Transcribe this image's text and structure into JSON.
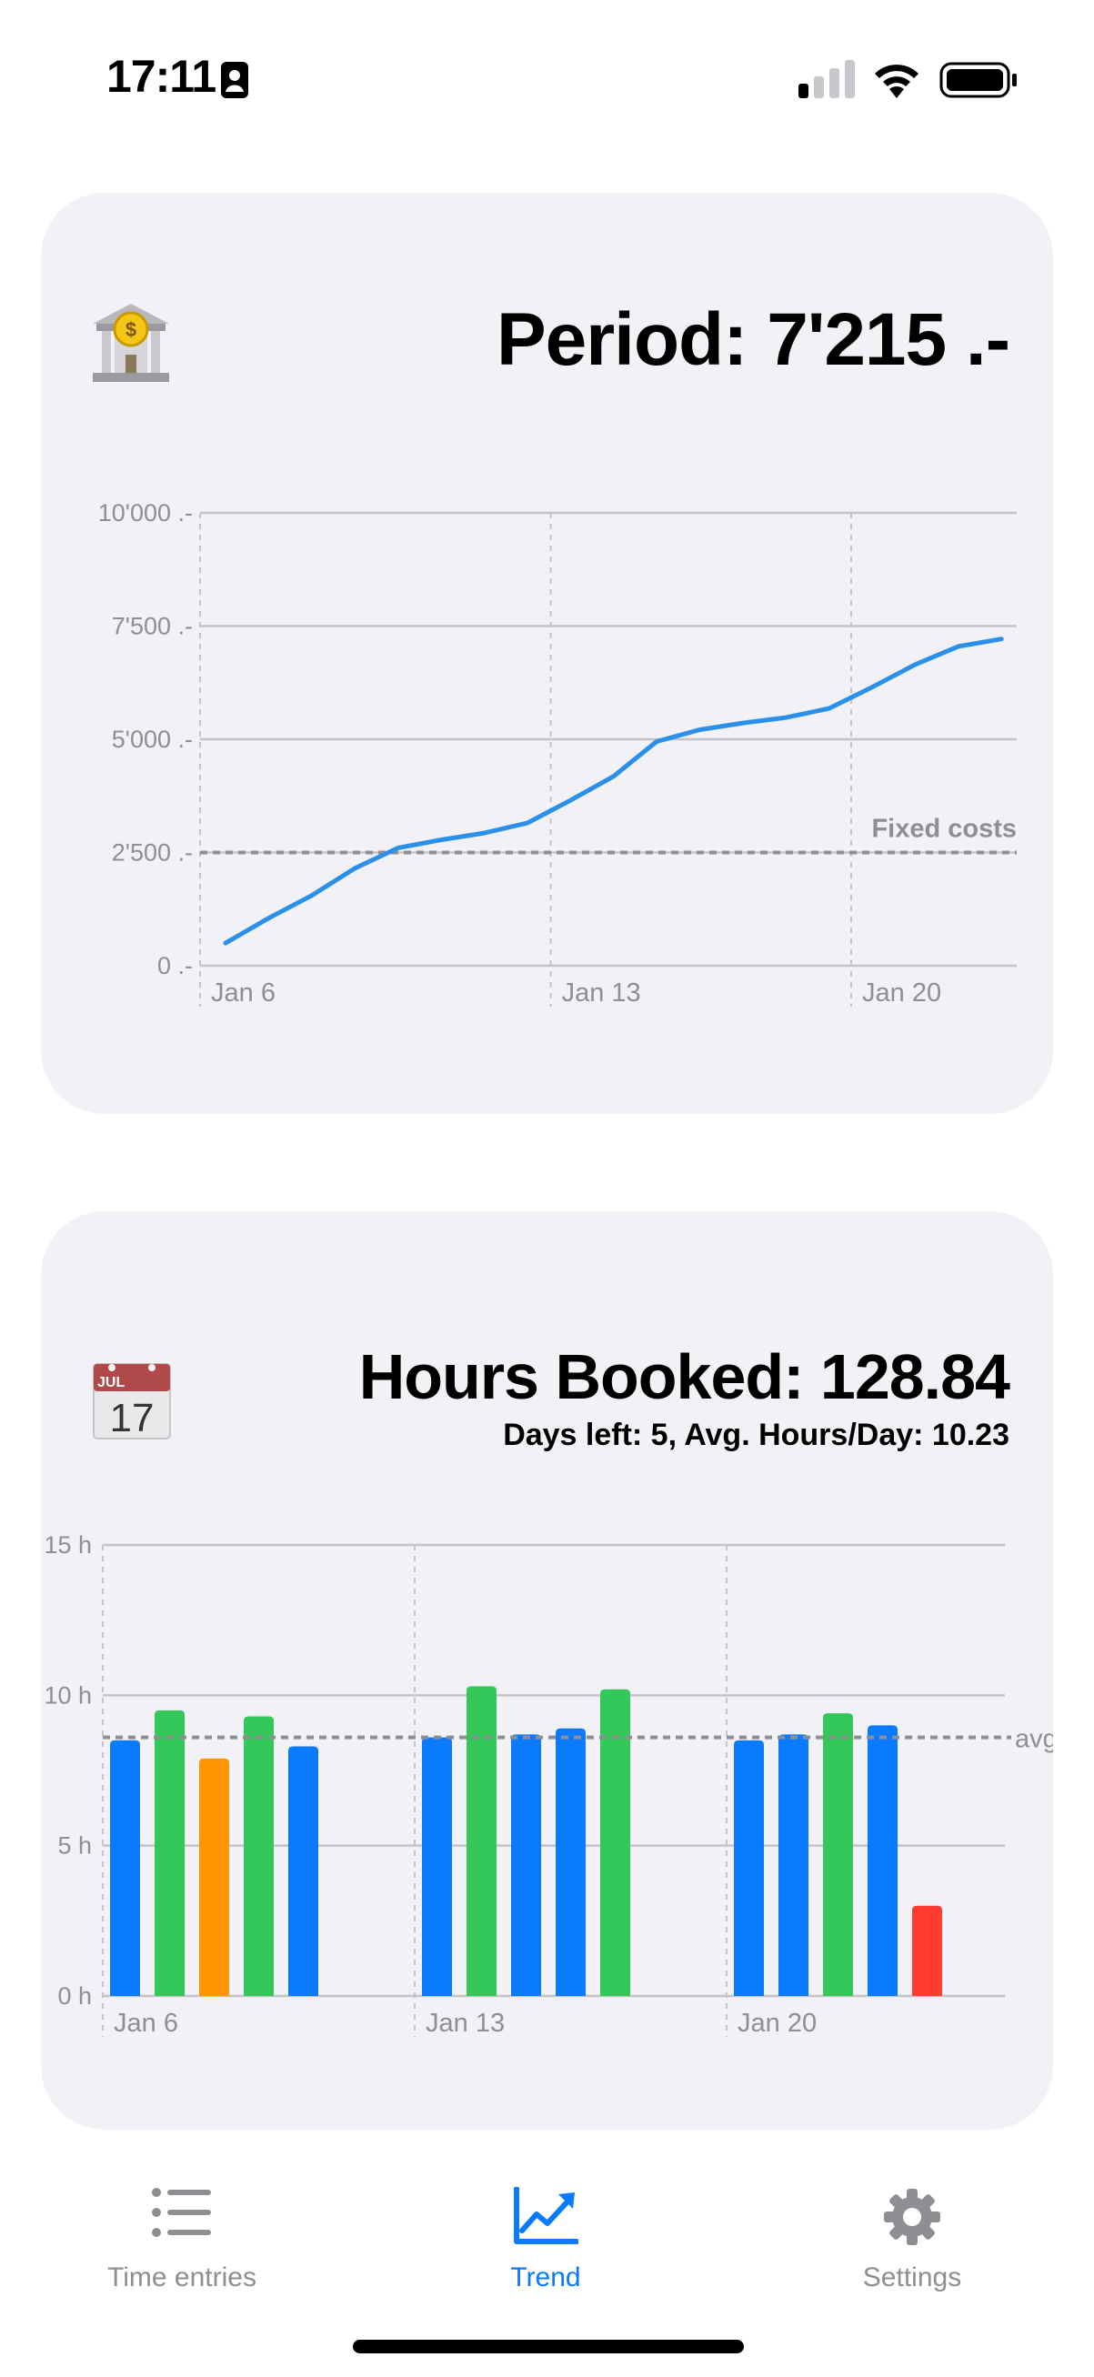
{
  "status_bar": {
    "time": "17:11"
  },
  "revenue_card": {
    "icon": "bank-icon",
    "title": "Period: 7'215 .-",
    "chart_data": {
      "type": "line",
      "x": [
        "Jan 5",
        "Jan 6",
        "Jan 7",
        "Jan 8",
        "Jan 9",
        "Jan 10",
        "Jan 11",
        "Jan 12",
        "Jan 13",
        "Jan 14",
        "Jan 15",
        "Jan 16",
        "Jan 17",
        "Jan 18",
        "Jan 19",
        "Jan 20",
        "Jan 21",
        "Jan 22",
        "Jan 23",
        "Jan 24"
      ],
      "series": [
        {
          "values": [
            500,
            1050,
            1550,
            2150,
            2600,
            2780,
            2930,
            3150,
            3650,
            4180,
            4950,
            5210,
            5360,
            5480,
            5680,
            6150,
            6650,
            7050,
            7215,
            null
          ]
        }
      ],
      "x_tick_labels": [
        "Jan 6",
        "Jan 13",
        "Jan 20"
      ],
      "y_tick_labels": [
        "10'000 .-",
        "7'500 .-",
        "5'000 .-",
        "2'500 .-",
        "0 .-"
      ],
      "y_ticks": [
        10000,
        7500,
        5000,
        2500,
        0
      ],
      "ylim": [
        0,
        10000
      ],
      "reference_line": {
        "label": "Fixed costs",
        "value": 2500
      },
      "grid": true,
      "line_color": "#2b90ea"
    }
  },
  "hours_card": {
    "icon": "calendar-icon",
    "icon_month": "JUL",
    "icon_day": "17",
    "title": "Hours Booked: 128.84",
    "subtitle": "Days left: 5, Avg. Hours/Day: 10.23",
    "chart_data": {
      "type": "bar",
      "categories": [
        "Jan 6",
        "Jan 7",
        "Jan 8",
        "Jan 9",
        "Jan 10",
        "Jan 13",
        "Jan 14",
        "Jan 15",
        "Jan 16",
        "Jan 17",
        "Jan 20",
        "Jan 21",
        "Jan 22",
        "Jan 23",
        "Jan 24"
      ],
      "values": [
        8.5,
        9.5,
        7.9,
        9.3,
        8.3,
        8.6,
        10.3,
        8.7,
        8.9,
        10.2,
        8.5,
        8.7,
        9.4,
        9.0,
        3.0
      ],
      "colors": [
        "#0a7afe",
        "#34c759",
        "#ff9500",
        "#34c759",
        "#0a7afe",
        "#0a7afe",
        "#34c759",
        "#0a7afe",
        "#0a7afe",
        "#34c759",
        "#0a7afe",
        "#0a7afe",
        "#34c759",
        "#0a7afe",
        "#ff3b30"
      ],
      "x_tick_labels": [
        "Jan 6",
        "Jan 13",
        "Jan 20"
      ],
      "y_tick_labels": [
        "15 h",
        "10 h",
        "5 h",
        "0 h"
      ],
      "y_ticks": [
        15,
        10,
        5,
        0
      ],
      "ylim": [
        0,
        15
      ],
      "reference_line": {
        "label": "avg",
        "value": 8.6
      },
      "grid": true
    }
  },
  "tab_bar": {
    "tabs": [
      {
        "label": "Time entries",
        "icon": "list-icon",
        "active": false
      },
      {
        "label": "Trend",
        "icon": "chart-line-icon",
        "active": true
      },
      {
        "label": "Settings",
        "icon": "gear-icon",
        "active": false
      }
    ],
    "active_color": "#0a7afe",
    "inactive_color": "#8e8e93"
  }
}
